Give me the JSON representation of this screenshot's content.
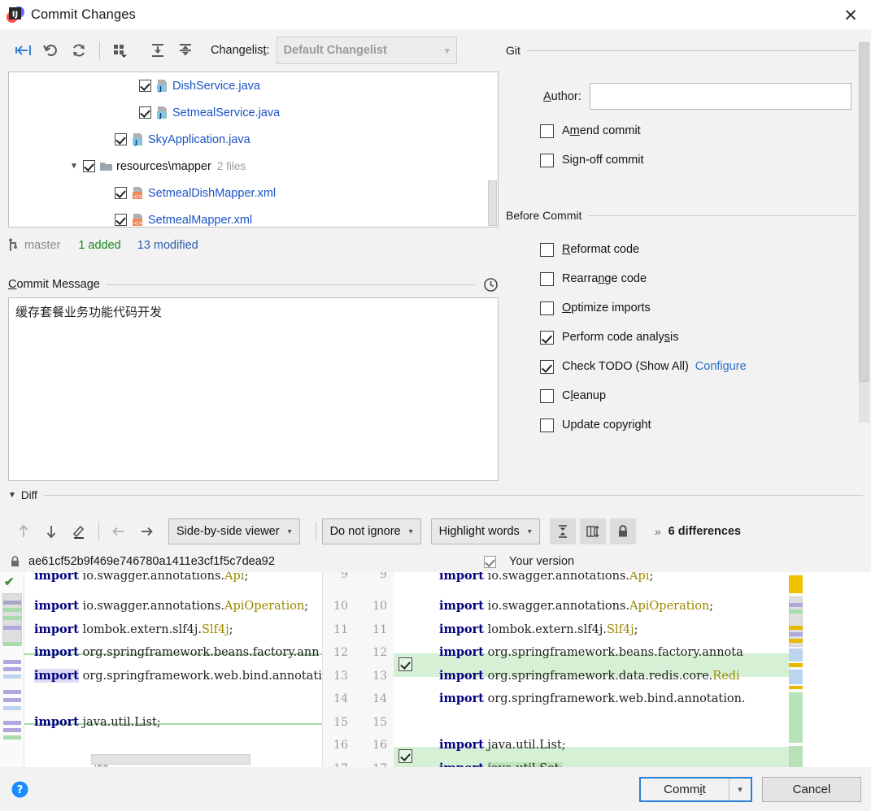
{
  "window": {
    "title": "Commit Changes",
    "logo_icon": "intellij-idea-logo",
    "close_icon": "close-icon"
  },
  "toolbar": {
    "buttons": [
      {
        "name": "show-diff-icon",
        "label": "Show Diff"
      },
      {
        "name": "revert-icon",
        "label": "Revert"
      },
      {
        "name": "refresh-icon",
        "label": "Refresh"
      },
      {
        "name": "group-by-icon",
        "label": "Group By"
      },
      {
        "name": "expand-all-icon",
        "label": "Expand All"
      },
      {
        "name": "collapse-all-icon",
        "label": "Collapse All"
      }
    ],
    "changelist_label": "Changelist:",
    "changelist_value": "Default Changelist",
    "changelist_chevron": "chevron-down-icon"
  },
  "tree": {
    "rows": [
      {
        "name": "DishService.java",
        "indent": 160,
        "checked": true,
        "icon": "java-file-icon",
        "type": "file",
        "meta": ""
      },
      {
        "name": "SetmealService.java",
        "indent": 160,
        "checked": true,
        "icon": "java-file-icon",
        "type": "file",
        "meta": ""
      },
      {
        "name": "SkyApplication.java",
        "indent": 130,
        "checked": true,
        "icon": "java-file-icon",
        "type": "file",
        "meta": ""
      },
      {
        "name": "resources\\mapper",
        "indent": 72,
        "checked": true,
        "icon": "folder-icon",
        "type": "folder",
        "meta": "2 files",
        "expanded": true
      },
      {
        "name": "SetmealDishMapper.xml",
        "indent": 130,
        "checked": true,
        "icon": "xml-file-icon",
        "type": "file",
        "meta": ""
      },
      {
        "name": "SetmealMapper.xml",
        "indent": 130,
        "checked": true,
        "icon": "xml-file-icon",
        "type": "file",
        "meta": ""
      }
    ]
  },
  "status": {
    "branch_icon": "git-branch-icon",
    "branch": "master",
    "added": "1 added",
    "modified": "13 modified"
  },
  "commit_message": {
    "label": "Commit Message",
    "label_mnemonic": "C",
    "label_rest": "ommit Message",
    "history_icon": "clock-history-icon",
    "value": "缓存套餐业务功能代码开发"
  },
  "git_section": {
    "title": "Git",
    "author_label": "Author:",
    "author_value": "",
    "checkboxes": [
      {
        "label": "Amend commit",
        "checked": false,
        "name": "amend-commit-checkbox"
      },
      {
        "label": "Sign-off commit",
        "checked": false,
        "name": "sign-off-commit-checkbox"
      }
    ]
  },
  "before_commit_section": {
    "title": "Before Commit",
    "checkboxes": [
      {
        "label": "Reformat code",
        "checked": false,
        "name": "reformat-code-checkbox"
      },
      {
        "label": "Rearrange code",
        "checked": false,
        "name": "rearrange-code-checkbox"
      },
      {
        "label": "Optimize imports",
        "checked": false,
        "name": "optimize-imports-checkbox"
      },
      {
        "label": "Perform code analysis",
        "checked": true,
        "name": "perform-code-analysis-checkbox"
      },
      {
        "label": "Check TODO (Show All)",
        "checked": true,
        "name": "check-todo-checkbox",
        "link": "Configure"
      },
      {
        "label": "Cleanup",
        "checked": false,
        "name": "cleanup-checkbox"
      },
      {
        "label": "Update copyright",
        "checked": false,
        "name": "update-copyright-checkbox"
      }
    ]
  },
  "diff": {
    "section_label": "Diff",
    "section_twisty": "triangle-down-icon",
    "toolbar_icons": [
      {
        "name": "previous-difference-icon"
      },
      {
        "name": "next-difference-icon"
      },
      {
        "name": "edit-source-icon"
      },
      {
        "name": "accept-left-icon"
      },
      {
        "name": "accept-right-icon"
      }
    ],
    "viewer_mode": "Side-by-side viewer",
    "ignore_mode": "Do not ignore",
    "highlight_mode": "Highlight words",
    "square_buttons": [
      {
        "name": "collapse-unchanged-icon"
      },
      {
        "name": "synchronize-scrolling-icon"
      },
      {
        "name": "read-only-lock-icon"
      }
    ],
    "differences_arrows": "»",
    "differences_count": "6 differences",
    "left_lock_icon": "lock-icon",
    "left_revision": "ae61cf52b9f469e746780a1411e3cf1f5c7dea92",
    "right_checkbox_checked": true,
    "right_revision": "Your version",
    "left_lines": [
      {
        "num": "9",
        "text": "import io.swagger.annotations.Api;",
        "state": "clipped"
      },
      {
        "num": "10",
        "text": "import io.swagger.annotations.ApiOperation;",
        "state": "normal"
      },
      {
        "num": "11",
        "text": "import lombok.extern.slf4j.Slf4j;",
        "state": "normal"
      },
      {
        "num": "12",
        "text": "import org.springframework.beans.factory.ann",
        "state": "normal"
      },
      {
        "num": "13",
        "text": "import org.springframework.web.bind.annotati",
        "state": "highlight"
      },
      {
        "num": "14",
        "text": "",
        "state": "empty"
      },
      {
        "num": "15",
        "text": "import java.util.List;",
        "state": "normal"
      },
      {
        "num": "16",
        "text": "",
        "state": "empty"
      },
      {
        "num": "17",
        "text": "/**",
        "state": "comment"
      }
    ],
    "right_lines": [
      {
        "num": "9",
        "text": "import io.swagger.annotations.Api;",
        "state": "clipped",
        "inserted": false
      },
      {
        "num": "10",
        "text": "import io.swagger.annotations.ApiOperation;",
        "state": "normal",
        "inserted": false
      },
      {
        "num": "11",
        "text": "import lombok.extern.slf4j.Slf4j;",
        "state": "normal",
        "inserted": false
      },
      {
        "num": "12",
        "text": "import org.springframework.beans.factory.annota",
        "state": "normal",
        "inserted": false
      },
      {
        "num": "13",
        "text": "import org.springframework.data.redis.core.Redi",
        "state": "added",
        "inserted": true
      },
      {
        "num": "14",
        "text": "import org.springframework.web.bind.annotation.",
        "state": "normal",
        "inserted": false
      },
      {
        "num": "15",
        "text": "",
        "state": "empty",
        "inserted": false
      },
      {
        "num": "16",
        "text": "import java.util.List;",
        "state": "normal",
        "inserted": false
      },
      {
        "num": "17",
        "text": "import java.util.Set;",
        "state": "added",
        "inserted": true
      }
    ]
  },
  "footer": {
    "help_icon": "help-icon",
    "commit_label": "Commit",
    "commit_mnemonic_pre": "Comm",
    "commit_mnemonic": "i",
    "commit_mnemonic_post": "t",
    "commit_dropdown_icon": "chevron-down-icon",
    "cancel_label": "Cancel"
  },
  "colors": {
    "accent_blue": "#2a7fd4",
    "link_blue": "#2a6fc9",
    "file_blue": "#1a52c8",
    "added_green": "#1a8a1a",
    "modified_blue": "#2b5fa8",
    "diff_added_bg": "#d5f0d5",
    "panel_bg": "#f2f2f2"
  }
}
